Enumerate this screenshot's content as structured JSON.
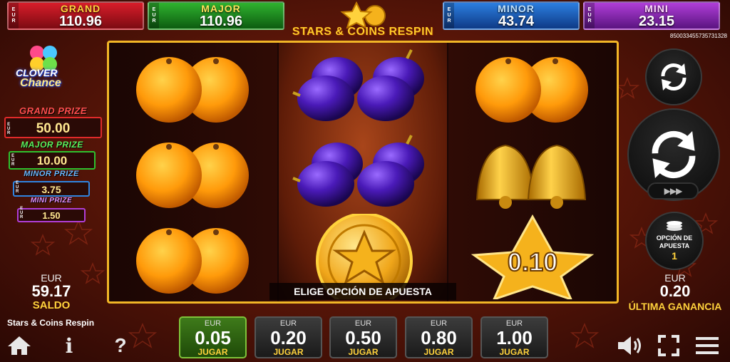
{
  "jackpots": {
    "grand": {
      "label": "GRAND",
      "value": "110.96",
      "currency": "EUR"
    },
    "major": {
      "label": "MAJOR",
      "value": "110.96",
      "currency": "EUR"
    },
    "minor": {
      "label": "MINOR",
      "value": "43.74",
      "currency": "EUR"
    },
    "mini": {
      "label": "MINI",
      "value": "23.15",
      "currency": "EUR"
    }
  },
  "game_logo": "STARS & COINS RESPIN",
  "serial": "850033455735731328",
  "side_logo": {
    "line1": "CLOVER",
    "line2": "Chance"
  },
  "prizes": {
    "grand": {
      "label": "GRAND PRIZE",
      "value": "50.00",
      "currency": "EUR"
    },
    "major": {
      "label": "MAJOR PRIZE",
      "value": "10.00",
      "currency": "EUR"
    },
    "minor": {
      "label": "MINOR PRIZE",
      "value": "3.75",
      "currency": "EUR"
    },
    "mini": {
      "label": "MINI PRIZE",
      "value": "1.50",
      "currency": "EUR"
    }
  },
  "balance": {
    "currency": "EUR",
    "value": "59.17",
    "label": "SALDO"
  },
  "game_name": "Stars & Coins Respin",
  "reels": {
    "col1": [
      "oranges",
      "oranges",
      "oranges"
    ],
    "col2": [
      "plums",
      "plums",
      "gold-coin-star"
    ],
    "col3": [
      "oranges",
      "bells",
      "star-value"
    ],
    "star_value": "0.10"
  },
  "message": "ELIGE OPCIÓN DE APUESTA",
  "controls": {
    "turbo_label": "▶▶▶",
    "bet_option_label": "OPCIÓN DE APUESTA",
    "bet_option_value": "1"
  },
  "last_win": {
    "currency": "EUR",
    "value": "0.20",
    "label": "ÚLTIMA GANANCIA"
  },
  "bets": [
    {
      "currency": "EUR",
      "value": "0.05",
      "label": "JUGAR",
      "active": true
    },
    {
      "currency": "EUR",
      "value": "0.20",
      "label": "JUGAR",
      "active": false
    },
    {
      "currency": "EUR",
      "value": "0.50",
      "label": "JUGAR",
      "active": false
    },
    {
      "currency": "EUR",
      "value": "0.80",
      "label": "JUGAR",
      "active": false
    },
    {
      "currency": "EUR",
      "value": "1.00",
      "label": "JUGAR",
      "active": false
    }
  ],
  "footer": {
    "home_icon": "home-icon",
    "info_icon": "info-icon",
    "help_icon": "help-icon",
    "info_glyph": "i",
    "help_glyph": "?",
    "sound_icon": "speaker-icon",
    "fullscreen_icon": "fullscreen-icon",
    "menu_icon": "hamburger-menu-icon"
  },
  "colors": {
    "accent_gold": "#ffd23c",
    "active_bet": "#3e7a1a",
    "reel_border": "#f2b626"
  }
}
